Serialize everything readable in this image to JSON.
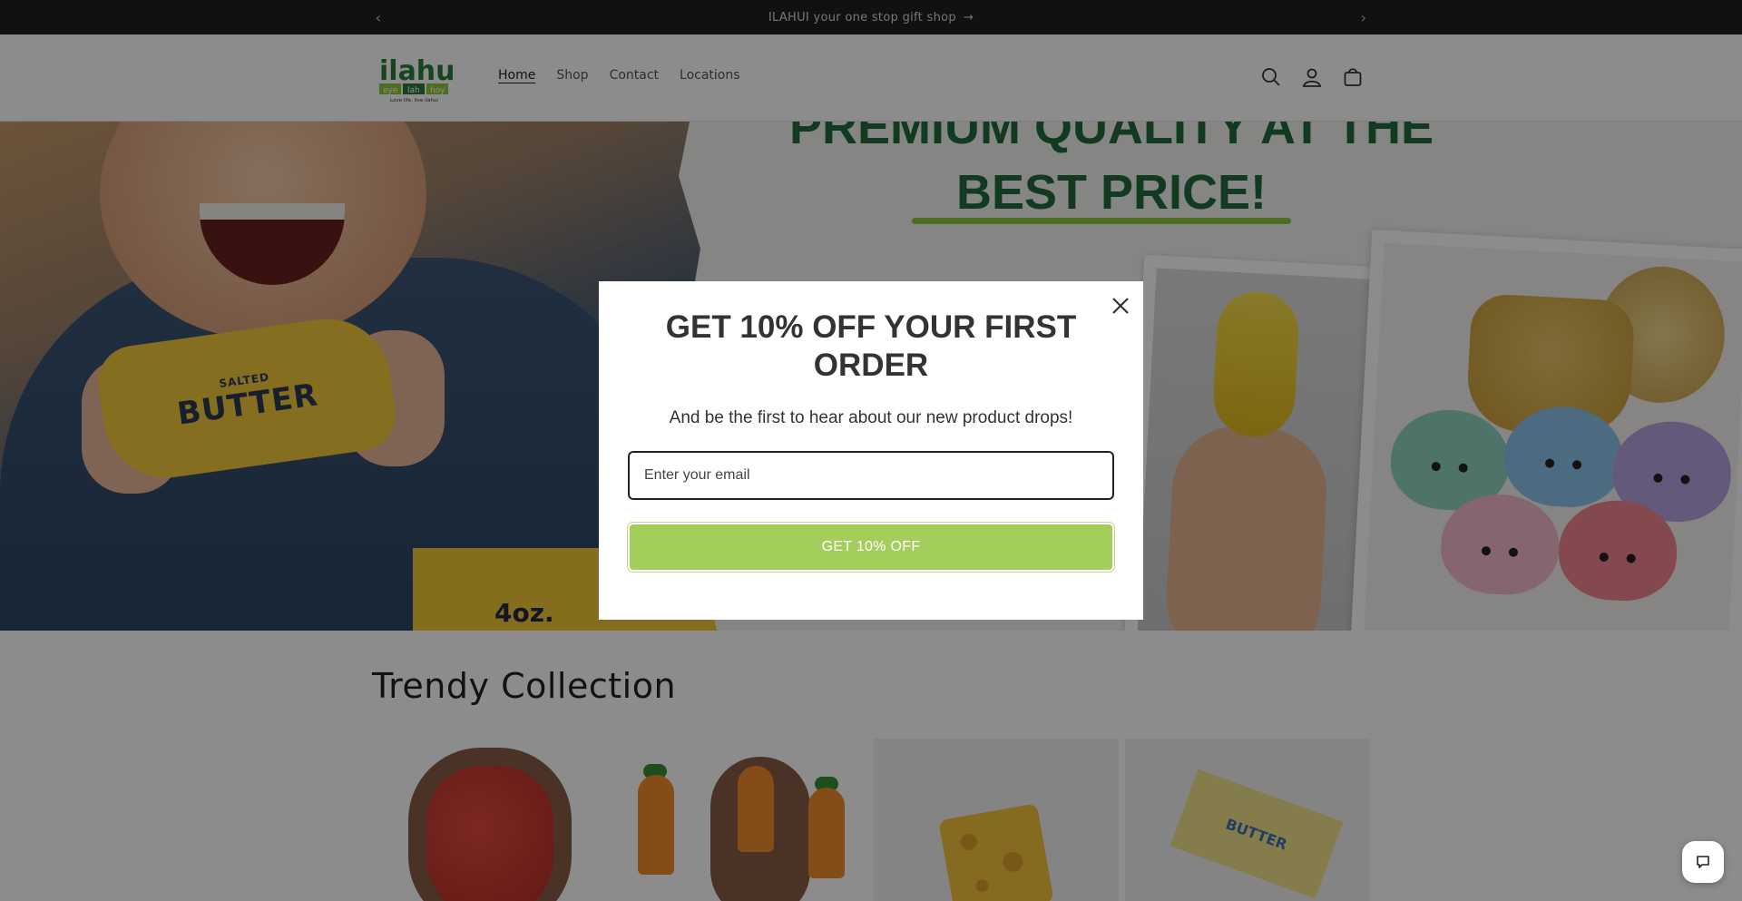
{
  "announcement": {
    "text": "ILAHUI your one stop gift shop",
    "arrow": "→",
    "prev_icon": "chevron-left-icon",
    "next_icon": "chevron-right-icon"
  },
  "header": {
    "logo": {
      "word": "ilahui",
      "tag1": "eye",
      "tag2": "lah",
      "tag3": "hoy",
      "tagline": "Love life, live ilahui",
      "mark": "ilahui"
    },
    "nav": [
      {
        "label": "Home",
        "active": true
      },
      {
        "label": "Shop",
        "active": false
      },
      {
        "label": "Contact",
        "active": false
      },
      {
        "label": "Locations",
        "active": false
      }
    ],
    "icons": [
      "search-icon",
      "account-icon",
      "cart-icon"
    ]
  },
  "hero": {
    "headline_line1": "PREMIUM QUALITY AT THE",
    "headline_line2": "BEST PRICE!",
    "butter_small": "SALTED",
    "butter_big": "BUTTER",
    "box_label": "4oz.",
    "accent_color": "#1f6b3d",
    "underline_color": "#8dc63f"
  },
  "collection": {
    "title": "Trendy Collection",
    "card4_label": "BUTTER"
  },
  "modal": {
    "title": "GET 10% OFF YOUR FIRST ORDER",
    "subtitle": "And be the first to hear about our new product drops!",
    "email_placeholder": "Enter your email",
    "cta_label": "GET 10% OFF",
    "cta_color": "#a4ce5b",
    "close_icon": "close-icon"
  },
  "chat": {
    "icon": "chat-icon"
  }
}
